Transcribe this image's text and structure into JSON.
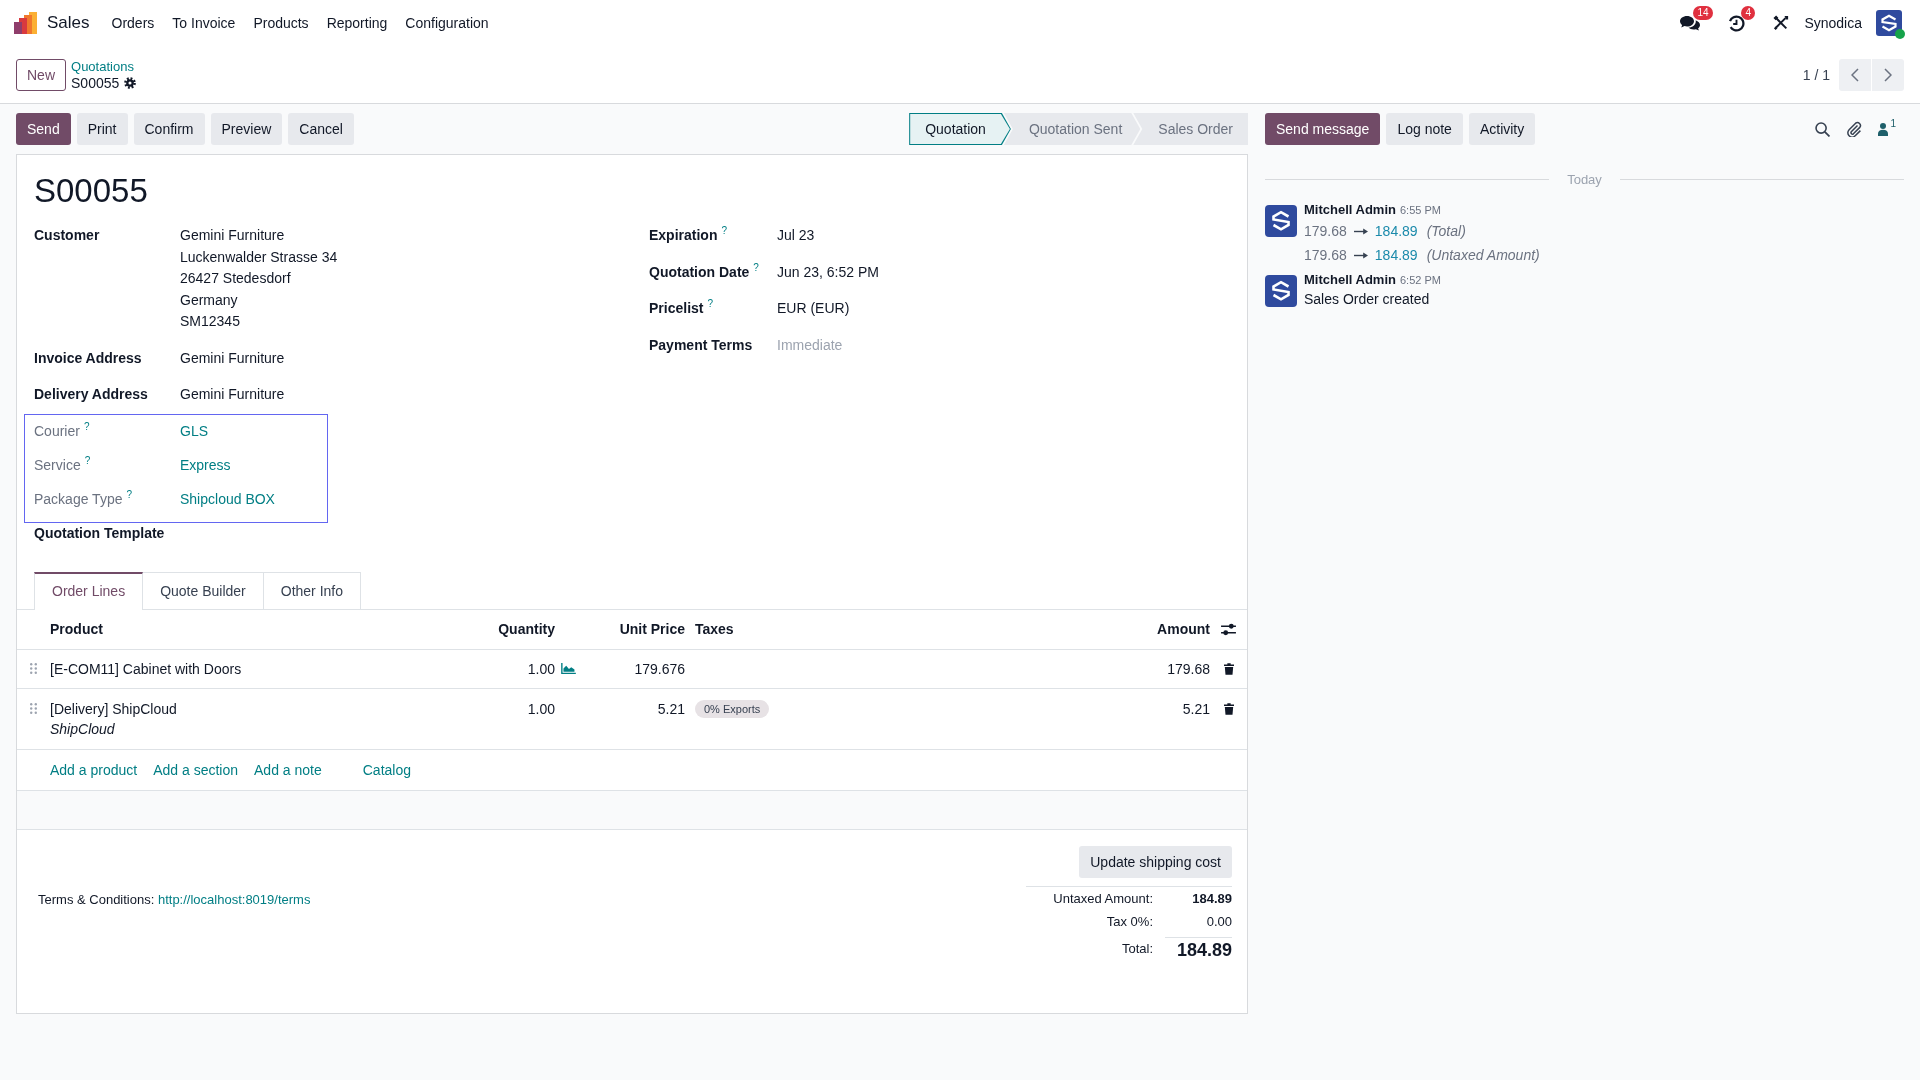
{
  "navbar": {
    "app_name": "Sales",
    "menu": [
      "Orders",
      "To Invoice",
      "Products",
      "Reporting",
      "Configuration"
    ],
    "systray": [
      {
        "kind": "messages",
        "badge": "14"
      },
      {
        "kind": "activities",
        "badge": "4"
      },
      {
        "kind": "debug"
      }
    ],
    "company": "Synodica",
    "user_online": true
  },
  "control_panel": {
    "new_button": "New",
    "breadcrumb": {
      "parent": "Quotations",
      "current": "S00055"
    },
    "pager": "1 / 1"
  },
  "action_buttons": [
    {
      "label": "Send",
      "primary": true
    },
    {
      "label": "Print",
      "primary": false
    },
    {
      "label": "Confirm",
      "primary": false
    },
    {
      "label": "Preview",
      "primary": false
    },
    {
      "label": "Cancel",
      "primary": false
    }
  ],
  "statusbar": [
    {
      "label": "Quotation",
      "selected": true
    },
    {
      "label": "Quotation Sent",
      "selected": false
    },
    {
      "label": "Sales Order",
      "selected": false
    }
  ],
  "form": {
    "title": "S00055",
    "left_groups": [
      {
        "highlighted": false,
        "fields": [
          {
            "label": "Customer",
            "readonly": false,
            "kind": "text",
            "lines": [
              "Gemini Furniture",
              "Luckenwalder Strasse 34",
              "26427 Stedesdorf",
              "Germany",
              "SM12345"
            ]
          },
          {
            "label": "Invoice Address",
            "readonly": false,
            "kind": "text",
            "lines": [
              "Gemini Furniture"
            ]
          },
          {
            "label": "Delivery Address",
            "readonly": false,
            "kind": "text",
            "lines": [
              "Gemini Furniture"
            ]
          }
        ]
      },
      {
        "highlighted": true,
        "fields": [
          {
            "label": "Courier",
            "help_mark": "?",
            "readonly": true,
            "kind": "link",
            "lines": [
              "GLS"
            ]
          },
          {
            "label": "Service",
            "help_mark": "?",
            "readonly": true,
            "kind": "link",
            "lines": [
              "Express"
            ]
          },
          {
            "label": "Package Type",
            "help_mark": "?",
            "readonly": true,
            "kind": "link",
            "lines": [
              "Shipcloud BOX"
            ]
          }
        ]
      },
      {
        "highlighted": false,
        "fields": [
          {
            "label": "Quotation Template",
            "readonly": false
          }
        ]
      }
    ],
    "right_fields": [
      {
        "label": "Expiration",
        "help_mark": "?",
        "readonly": false,
        "kind": "text",
        "lines": [
          "Jul 23"
        ]
      },
      {
        "label": "Quotation Date",
        "help_mark": "?",
        "readonly": false,
        "kind": "text",
        "lines": [
          "Jun 23, 6:52 PM"
        ]
      },
      {
        "label": "Pricelist",
        "help_mark": "?",
        "readonly": false,
        "kind": "text",
        "lines": [
          "EUR (EUR)"
        ]
      },
      {
        "label": "Payment Terms",
        "readonly": false,
        "kind": "input",
        "placeholder": "Immediate"
      }
    ],
    "tabs": [
      {
        "label": "Order Lines",
        "selected": true
      },
      {
        "label": "Quote Builder",
        "selected": false
      },
      {
        "label": "Other Info",
        "selected": false
      }
    ],
    "table": {
      "columns": [
        "Product",
        "Quantity",
        "Unit Price",
        "Taxes",
        "Amount"
      ],
      "rows": [
        {
          "product": "[E-COM11] Cabinet with Doors",
          "quantity": "1.00",
          "show_forecast": true,
          "unit_price": "179.676",
          "amount": "179.68"
        },
        {
          "product": "[Delivery] ShipCloud",
          "description": "ShipCloud",
          "quantity": "1.00",
          "show_forecast": false,
          "unit_price": "5.21",
          "taxes": [
            "0% Exports"
          ],
          "amount": "5.21"
        }
      ],
      "add_links": [
        {
          "kind": "add",
          "label": "Add a product"
        },
        {
          "kind": "add",
          "label": "Add a section"
        },
        {
          "kind": "add",
          "label": "Add a note"
        },
        {
          "kind": "catalog",
          "label": "Catalog"
        }
      ]
    },
    "footer": {
      "update_button": "Update shipping cost",
      "terms_label": "Terms & Conditions:",
      "terms_link": "http://localhost:8019/terms",
      "totals": [
        {
          "kind": "subtotal",
          "label": "Untaxed Amount:",
          "value": "184.89"
        },
        {
          "kind": "tax",
          "label": "Tax 0%:",
          "value": "0.00"
        },
        {
          "kind": "total",
          "label": "Total:",
          "value": "184.89"
        }
      ]
    }
  },
  "chatter": {
    "buttons": [
      {
        "label": "Send message",
        "primary": true
      },
      {
        "label": "Log note",
        "primary": false
      },
      {
        "label": "Activity",
        "primary": false
      }
    ],
    "followers_count": "1",
    "date_separator": "Today",
    "messages": [
      {
        "kind": "tracking",
        "author": "Mitchell Admin",
        "time": "6:55 PM",
        "changes": [
          {
            "old": "179.68",
            "new": "184.89",
            "field": "(Total)"
          },
          {
            "old": "179.68",
            "new": "184.89",
            "field": "(Untaxed Amount)"
          }
        ]
      },
      {
        "kind": "note",
        "author": "Mitchell Admin",
        "time": "6:52 PM",
        "body": "Sales Order created"
      }
    ]
  }
}
